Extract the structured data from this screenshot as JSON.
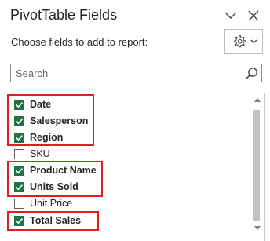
{
  "panel": {
    "title": "PivotTable Fields",
    "subtitle": "Choose fields to add to report:",
    "icons": {
      "collapse": "chevron-down-icon",
      "close": "close-icon",
      "settings": "gear-icon",
      "settings_caret": "caret-down-icon",
      "search": "search-icon"
    }
  },
  "search": {
    "placeholder": "Search",
    "value": ""
  },
  "fields": [
    {
      "label": "Date",
      "checked": true
    },
    {
      "label": "Salesperson",
      "checked": true
    },
    {
      "label": "Region",
      "checked": true
    },
    {
      "label": "SKU",
      "checked": false
    },
    {
      "label": "Product Name",
      "checked": true
    },
    {
      "label": "Units Sold",
      "checked": true
    },
    {
      "label": "Unit Price",
      "checked": false
    },
    {
      "label": "Total Sales",
      "checked": true
    }
  ],
  "colors": {
    "checkbox_checked": "#217346",
    "highlight": "#e02020"
  }
}
